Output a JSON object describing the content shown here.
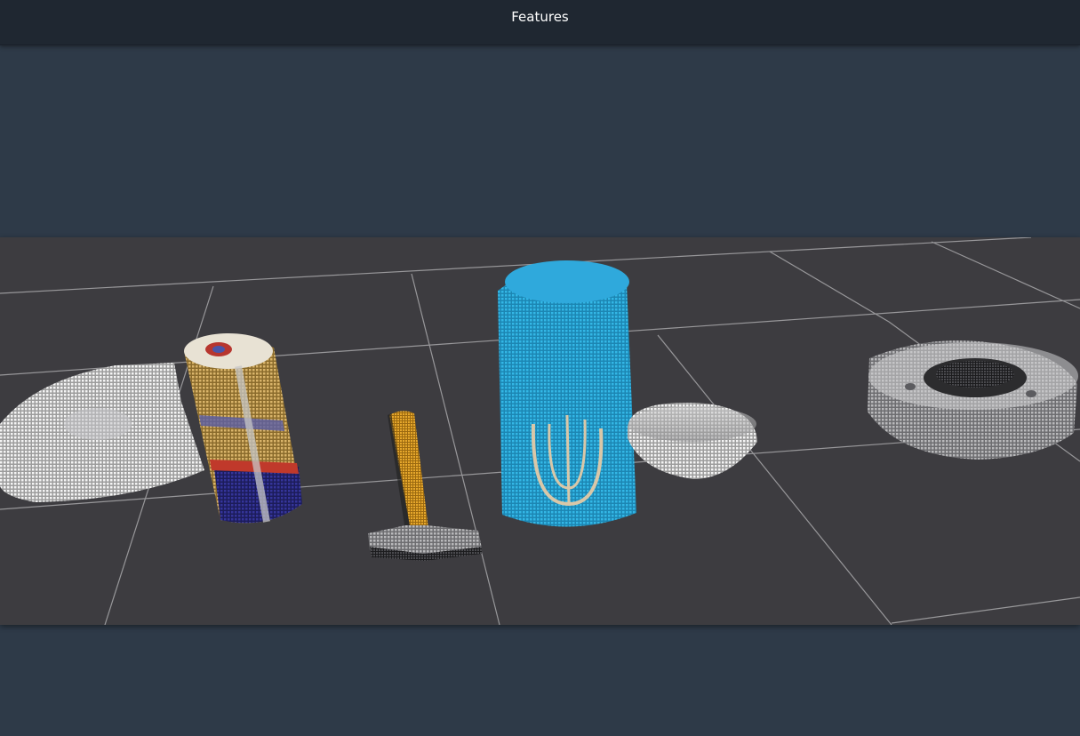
{
  "header": {
    "title": "Features"
  },
  "viewport": {
    "scene": "point-cloud-objects",
    "colors": {
      "page_background": "#2e3a48",
      "header_background": "#1f2731",
      "ground": "#3d3c40",
      "grid_lines": "#a8a8aa",
      "can_blue": "#27a9d9",
      "hammer_handle": "#e0a02a"
    }
  }
}
